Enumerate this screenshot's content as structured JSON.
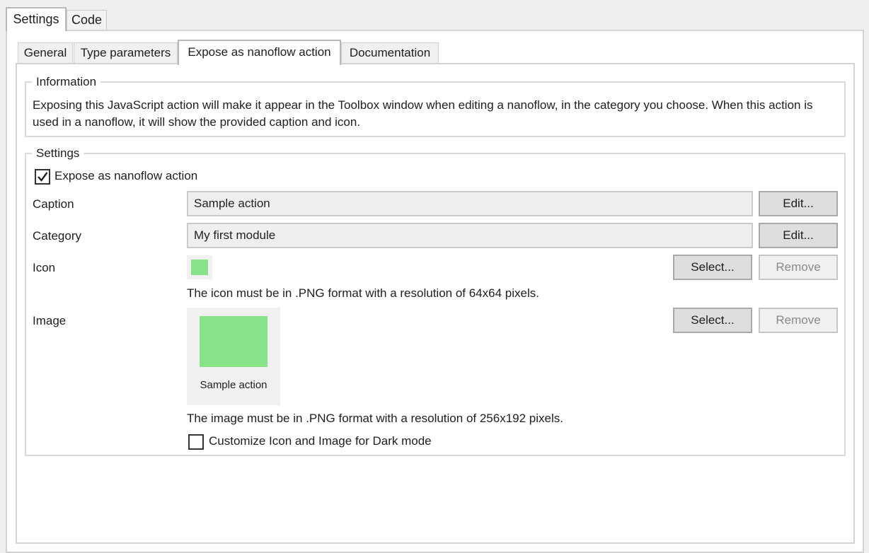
{
  "top_tabs": [
    {
      "label": "Settings",
      "active": true
    },
    {
      "label": "Code",
      "active": false
    }
  ],
  "inner_tabs": [
    {
      "label": "General",
      "active": false
    },
    {
      "label": "Type parameters",
      "active": false
    },
    {
      "label": "Expose as nanoflow action",
      "active": true
    },
    {
      "label": "Documentation",
      "active": false
    }
  ],
  "information": {
    "legend": "Information",
    "text": "Exposing this JavaScript action will make it appear in the Toolbox window when editing a nanoflow, in the category you choose. When this action is used in a nanoflow, it will show the provided caption and icon."
  },
  "settings": {
    "legend": "Settings",
    "expose_checkbox": {
      "label": "Expose as nanoflow action",
      "checked": true
    },
    "caption": {
      "label": "Caption",
      "value": "Sample action",
      "edit_label": "Edit..."
    },
    "category": {
      "label": "Category",
      "value": "My first module",
      "edit_label": "Edit..."
    },
    "icon": {
      "label": "Icon",
      "select_label": "Select...",
      "remove_label": "Remove",
      "hint": "The icon must be in .PNG format with a resolution of 64x64 pixels."
    },
    "image": {
      "label": "Image",
      "caption": "Sample action",
      "select_label": "Select...",
      "remove_label": "Remove",
      "hint": "The image must be in .PNG format with a resolution of 256x192 pixels."
    },
    "dark_mode_checkbox": {
      "label": "Customize Icon and Image for Dark mode",
      "checked": false
    }
  },
  "colors": {
    "preview_green": "#88e288",
    "background": "#efefef",
    "panel": "#ffffff"
  }
}
